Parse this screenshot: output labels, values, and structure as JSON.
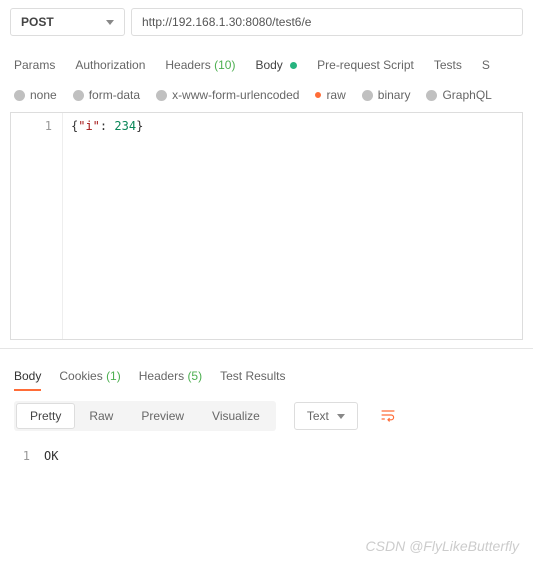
{
  "method": "POST",
  "url": "http://192.168.1.30:8080/test6/e",
  "tabs": {
    "params": "Params",
    "auth": "Authorization",
    "headers_label": "Headers",
    "headers_count": "(10)",
    "body": "Body",
    "prereq": "Pre-request Script",
    "tests": "Tests",
    "settings_cut": "S"
  },
  "body_types": {
    "none": "none",
    "formdata": "form-data",
    "xwww": "x-www-form-urlencoded",
    "raw": "raw",
    "binary": "binary",
    "graphql": "GraphQL"
  },
  "req_body": {
    "lineno": "1",
    "open": "{",
    "key": "\"i\"",
    "colon": ": ",
    "val": "234",
    "close": "}"
  },
  "resp_tabs": {
    "body": "Body",
    "cookies_label": "Cookies",
    "cookies_count": "(1)",
    "headers_label": "Headers",
    "headers_count": "(5)",
    "testres": "Test Results"
  },
  "format": {
    "pretty": "Pretty",
    "raw": "Raw",
    "preview": "Preview",
    "visualize": "Visualize",
    "lang": "Text"
  },
  "resp_body": {
    "lineno": "1",
    "text": "OK"
  },
  "watermark": "CSDN @FlyLikeButterfly"
}
